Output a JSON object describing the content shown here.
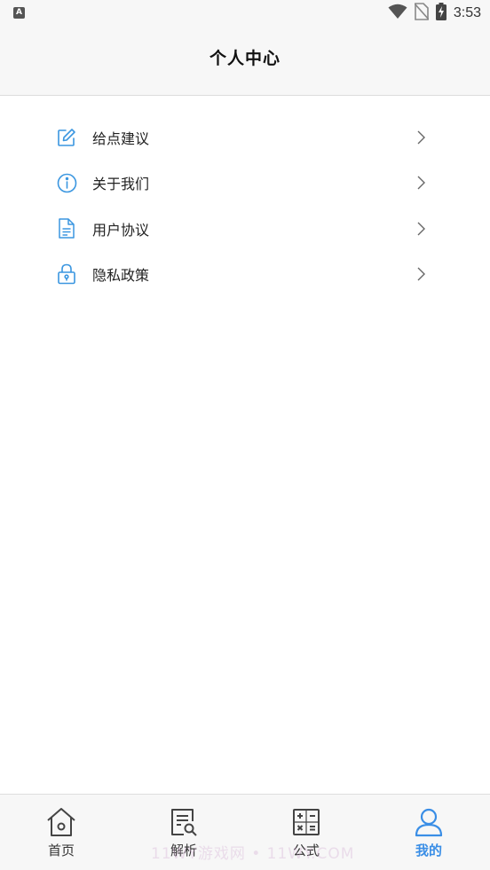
{
  "status_bar": {
    "time": "3:53",
    "left_badge": "A",
    "icons": [
      "wifi-icon",
      "no-sim-icon",
      "battery-charging-icon"
    ]
  },
  "header": {
    "title": "个人中心"
  },
  "menu": {
    "items": [
      {
        "label": "给点建议",
        "icon": "edit-icon"
      },
      {
        "label": "关于我们",
        "icon": "info-icon"
      },
      {
        "label": "用户协议",
        "icon": "document-icon"
      },
      {
        "label": "隐私政策",
        "icon": "lock-icon"
      }
    ]
  },
  "bottom_nav": {
    "items": [
      {
        "label": "首页",
        "icon": "home-icon",
        "active": false
      },
      {
        "label": "解析",
        "icon": "analysis-icon",
        "active": false
      },
      {
        "label": "公式",
        "icon": "calculator-icon",
        "active": false
      },
      {
        "label": "我的",
        "icon": "user-icon",
        "active": true
      }
    ]
  },
  "watermark": "11WY游戏网 • 11WY.COM",
  "colors": {
    "accent": "#3a8ee6",
    "icon_blue": "#3a96e0",
    "background": "#ffffff",
    "header_bg": "#f7f7f7",
    "text": "#222222"
  }
}
